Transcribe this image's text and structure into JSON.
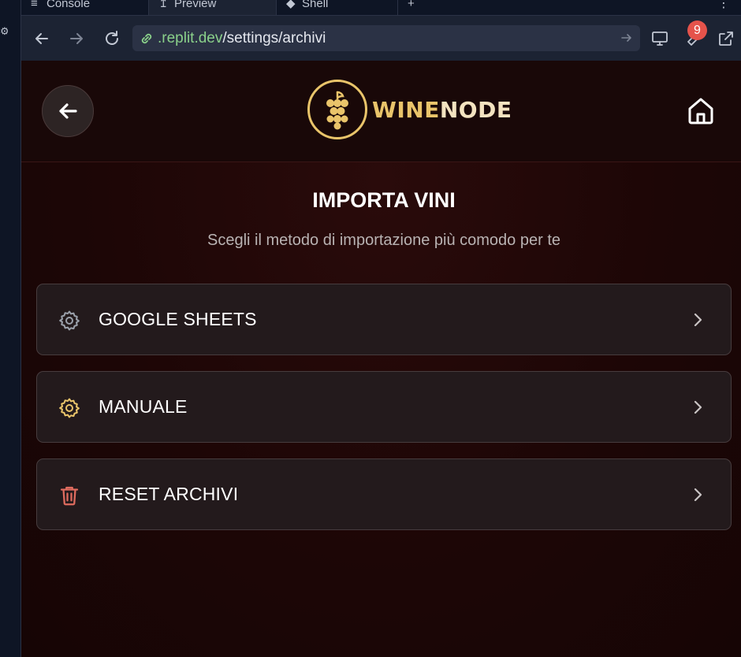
{
  "browser": {
    "tabs": [
      {
        "label": "Console",
        "icon": "terminal-icon"
      },
      {
        "label": "Preview",
        "icon": "preview-icon"
      },
      {
        "label": "Shell",
        "icon": "shell-icon"
      }
    ],
    "url": {
      "host": ".replit.dev",
      "path": "/settings/archivi"
    },
    "notification_count": "9"
  },
  "header": {
    "brand_primary": "WINE",
    "brand_secondary": "NODE"
  },
  "page": {
    "title": "IMPORTA VINI",
    "subtitle": "Scegli il metodo di importazione più comodo per te"
  },
  "options": [
    {
      "label": "GOOGLE SHEETS",
      "icon": "gear-icon",
      "color": "#9aa0aa"
    },
    {
      "label": "MANUALE",
      "icon": "gear-icon",
      "color": "#e9c46a"
    },
    {
      "label": "RESET ARCHIVI",
      "icon": "trash-icon",
      "color": "#e06c5f"
    }
  ],
  "colors": {
    "accent_gold": "#e9c46a",
    "danger": "#e06c5f",
    "badge": "#e5534b",
    "url_host": "#8ad08a"
  }
}
